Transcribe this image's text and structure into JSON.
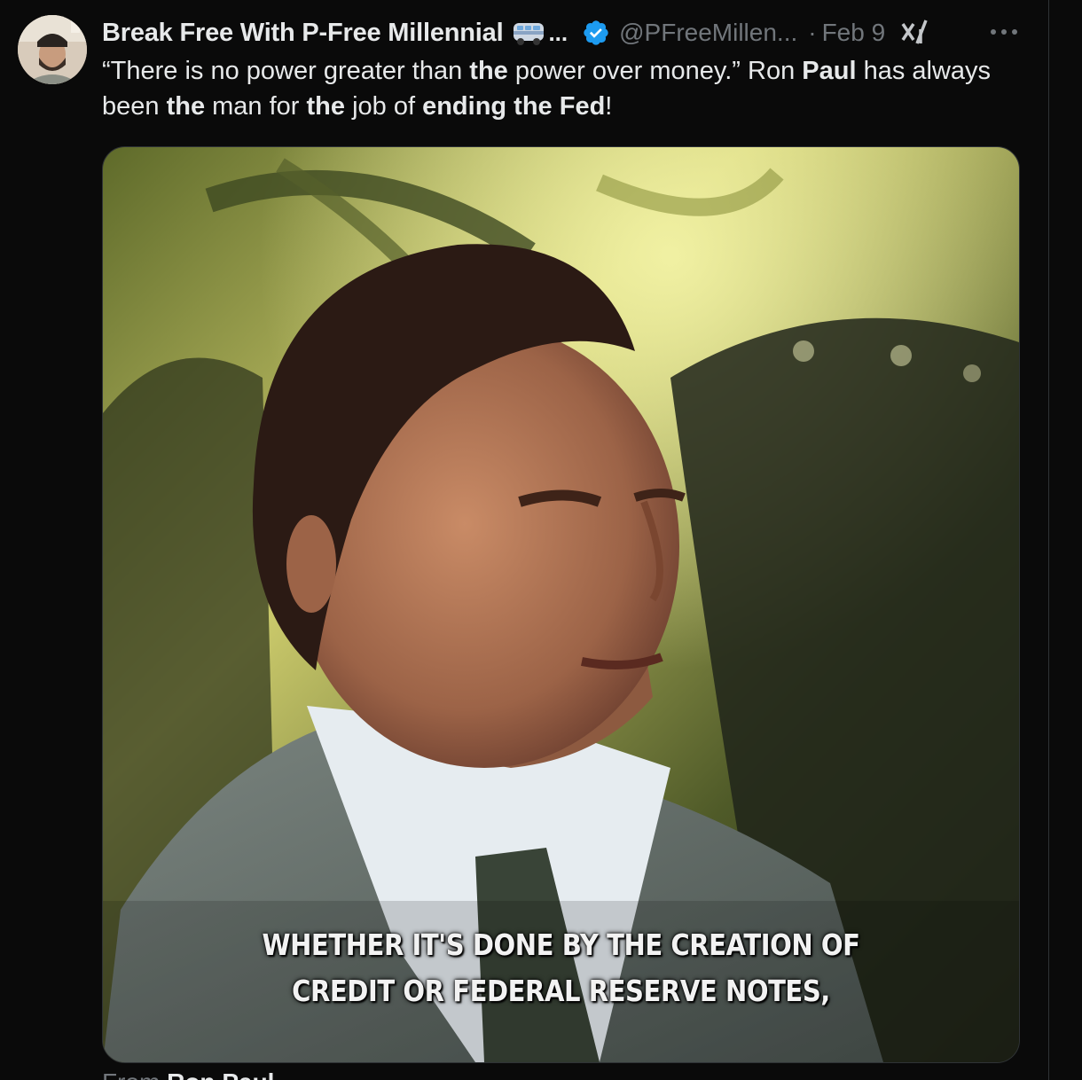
{
  "author": {
    "display_name": "Break Free With P-Free Millennial",
    "name_truncation": "...",
    "handle": "@PFreeMillen...",
    "separator": "·",
    "date": "Feb 9",
    "verified": true,
    "emoji_icon": "van-icon"
  },
  "tweet": {
    "text_segments": [
      {
        "text": "“There is no power greater than ",
        "bold": false
      },
      {
        "text": "the",
        "bold": true
      },
      {
        "text": " power over money.” Ron ",
        "bold": false
      },
      {
        "text": "Paul",
        "bold": true
      },
      {
        "text": " has always been ",
        "bold": false
      },
      {
        "text": "the",
        "bold": true
      },
      {
        "text": " man for ",
        "bold": false
      },
      {
        "text": "the",
        "bold": true
      },
      {
        "text": " job of ",
        "bold": false
      },
      {
        "text": "ending the Fed",
        "bold": true
      },
      {
        "text": "!",
        "bold": false
      }
    ]
  },
  "media": {
    "type": "video",
    "caption_line1": "WHETHER IT'S DONE BY THE CREATION OF",
    "caption_line2": "CREDIT OR FEDERAL RESERVE NOTES,"
  },
  "from_line": {
    "prefix": "From",
    "name": "Ron Paul"
  },
  "colors": {
    "background": "#0a0a0a",
    "text_primary": "#e7e9ea",
    "text_secondary": "#71767b",
    "verified_blue": "#1d9bf0",
    "divider": "#2f3336"
  }
}
